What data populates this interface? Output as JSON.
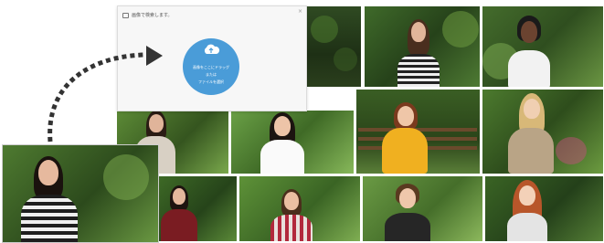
{
  "upload_dialog": {
    "title": "画像で検索します。",
    "close_label": "×",
    "drop_zone": {
      "line1": "画像をここにドラッグ",
      "line2": "または",
      "line3": "ファイルを選択"
    },
    "accent_color": "#4a9cd8"
  },
  "icons": {
    "dialog": "image-icon",
    "upload": "cloud-upload-icon",
    "close": "close-icon"
  },
  "photo_grid": {
    "tile_count": 15,
    "subjects": [
      "woman",
      "woman",
      "woman",
      "child",
      "woman",
      "woman",
      "man",
      "man",
      "woman",
      "woman",
      "man",
      "woman",
      "woman",
      "boy",
      "girl"
    ]
  },
  "dragged_preview": {
    "subject": "woman-striped-shirt"
  }
}
